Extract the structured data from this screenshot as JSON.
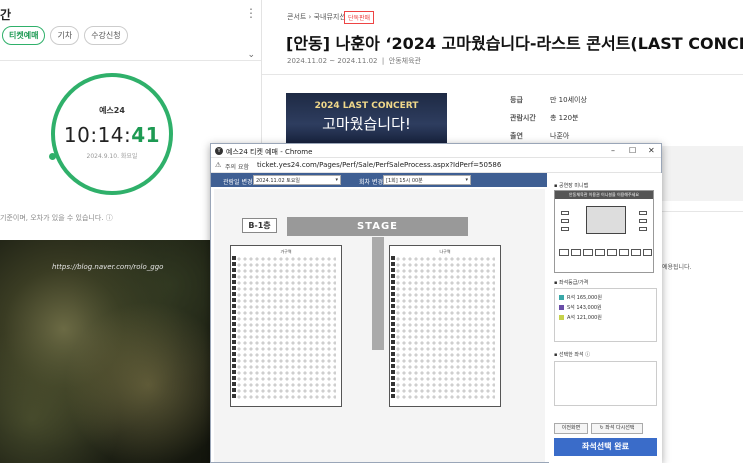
{
  "clock_panel": {
    "title": "간",
    "more": "⋮",
    "tabs": [
      {
        "label": "티켓예매",
        "active": true
      },
      {
        "label": "기차",
        "active": false
      },
      {
        "label": "수강신청",
        "active": false
      }
    ],
    "brand": "예스24",
    "time_hm": "10:14:",
    "time_s": "41",
    "date": "2024.9.10. 화요일",
    "note": "기준이며, 오차가 있을 수 있습니다."
  },
  "photo": {
    "watermark": "https://blog.naver.com/rolo_ggo"
  },
  "event": {
    "breadcrumb": "콘서트 › 국내뮤지션",
    "badge": "단독판매",
    "title": "[안동] 나훈아 ‘2024 고마웠습니다-라스트 콘서트(LAST CONCERT)’",
    "dates": "2024.11.02 ~ 2024.11.02",
    "venue": "안동체육관",
    "poster_line1": "2024 LAST CONCERT",
    "poster_line2": "고마웠습니다!",
    "info": [
      {
        "k": "등급",
        "v": "만 10세이상"
      },
      {
        "k": "관람시간",
        "v": "총 120분"
      },
      {
        "k": "출연",
        "v": "나훈아"
      }
    ],
    "side_note": "예용됩니다."
  },
  "popup": {
    "title": "예스24 티켓 예매 - Chrome",
    "warn_label": "주의 요함",
    "url": "ticket.yes24.com/Pages/Perf/Sale/PerfSaleProcess.aspx?IdPerf=50586",
    "date_label": "관람일 변경",
    "date_value": "2024.11.02 토요일",
    "time_label": "회차 변경",
    "time_value": "[1회] 15시 00분",
    "floor": "B-1층",
    "stage": "STAGE",
    "block_left": "가구역",
    "block_right": "나구역",
    "minimap_title": "공연장 미니맵",
    "minimap_header": "안동체육관 이용권 이니셜을 이용해주세요",
    "grade_title": "좌석등급/가격",
    "grades": [
      {
        "name": "R석",
        "price": "165,000원",
        "color": "#3aa8a8"
      },
      {
        "name": "S석",
        "price": "143,000원",
        "color": "#6a4ea8"
      },
      {
        "name": "A석",
        "price": "121,000원",
        "color": "#c6d24a"
      }
    ],
    "chosen_title": "선택한 좌석",
    "btn_prev": "이전화면",
    "btn_reset": "좌석 다시선택",
    "btn_done": "좌석선택 완료"
  }
}
